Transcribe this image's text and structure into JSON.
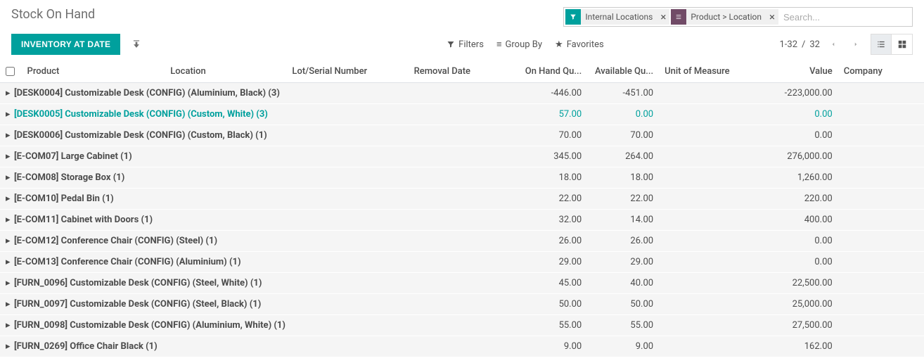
{
  "page_title": "Stock On Hand",
  "buttons": {
    "inventory_at_date": "INVENTORY AT DATE"
  },
  "search": {
    "placeholder": "Search...",
    "facets": [
      {
        "type": "filter",
        "label": "Internal Locations"
      },
      {
        "type": "group",
        "label": "Product > Location"
      }
    ]
  },
  "toolbar": {
    "filters": "Filters",
    "group_by": "Group By",
    "favorites": "Favorites"
  },
  "pager": {
    "range": "1-32",
    "total": "32",
    "sep": " / "
  },
  "columns": {
    "product": "Product",
    "location": "Location",
    "lot": "Lot/Serial Number",
    "removal": "Removal Date",
    "onhand": "On Hand Qu...",
    "available": "Available Qu...",
    "uom": "Unit of Measure",
    "value": "Value",
    "company": "Company"
  },
  "rows": [
    {
      "name": "[DESK0004] Customizable Desk (CONFIG) (Aluminium, Black) (3)",
      "onhand": "-446.00",
      "available": "-451.00",
      "value": "-223,000.00",
      "active": false
    },
    {
      "name": "[DESK0005] Customizable Desk (CONFIG) (Custom, White) (3)",
      "onhand": "57.00",
      "available": "0.00",
      "value": "0.00",
      "active": true
    },
    {
      "name": "[DESK0006] Customizable Desk (CONFIG) (Custom, Black) (1)",
      "onhand": "70.00",
      "available": "70.00",
      "value": "0.00",
      "active": false
    },
    {
      "name": "[E-COM07] Large Cabinet (1)",
      "onhand": "345.00",
      "available": "264.00",
      "value": "276,000.00",
      "active": false
    },
    {
      "name": "[E-COM08] Storage Box (1)",
      "onhand": "18.00",
      "available": "18.00",
      "value": "1,260.00",
      "active": false
    },
    {
      "name": "[E-COM10] Pedal Bin (1)",
      "onhand": "22.00",
      "available": "22.00",
      "value": "220.00",
      "active": false
    },
    {
      "name": "[E-COM11] Cabinet with Doors (1)",
      "onhand": "32.00",
      "available": "14.00",
      "value": "400.00",
      "active": false
    },
    {
      "name": "[E-COM12] Conference Chair (CONFIG) (Steel) (1)",
      "onhand": "26.00",
      "available": "26.00",
      "value": "0.00",
      "active": false
    },
    {
      "name": "[E-COM13] Conference Chair (CONFIG) (Aluminium) (1)",
      "onhand": "29.00",
      "available": "29.00",
      "value": "0.00",
      "active": false
    },
    {
      "name": "[FURN_0096] Customizable Desk (CONFIG) (Steel, White) (1)",
      "onhand": "45.00",
      "available": "40.00",
      "value": "22,500.00",
      "active": false
    },
    {
      "name": "[FURN_0097] Customizable Desk (CONFIG) (Steel, Black) (1)",
      "onhand": "50.00",
      "available": "50.00",
      "value": "25,000.00",
      "active": false
    },
    {
      "name": "[FURN_0098] Customizable Desk (CONFIG) (Aluminium, White) (1)",
      "onhand": "55.00",
      "available": "55.00",
      "value": "27,500.00",
      "active": false
    },
    {
      "name": "[FURN_0269] Office Chair Black (1)",
      "onhand": "9.00",
      "available": "9.00",
      "value": "162.00",
      "active": false
    }
  ]
}
